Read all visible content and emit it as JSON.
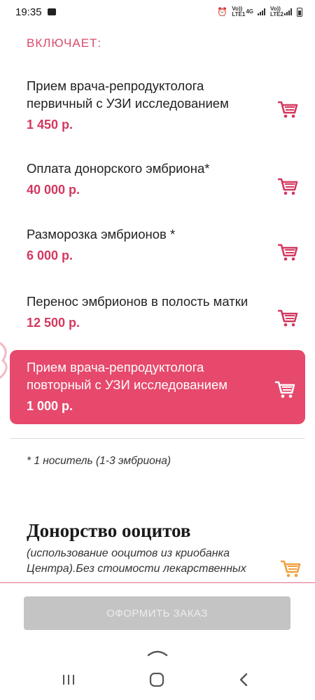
{
  "status": {
    "time": "19:35",
    "sim1_label": "Vo)) LTE1",
    "net": "4G",
    "sim2_label": "Vo)) LTE2"
  },
  "includes_label": "ВКЛЮЧАЕТ:",
  "items": [
    {
      "title": "Прием врача-репродуктолога первичный с УЗИ исследованием",
      "price": "1 450 р."
    },
    {
      "title": "Оплата донорского эмбриона*",
      "price": "40 000 р."
    },
    {
      "title": "Разморозка эмбрионов *",
      "price": "6 000 р."
    },
    {
      "title": "Перенос эмбрионов в полость матки",
      "price": "12 500 р."
    },
    {
      "title": "Прием врача-репродуктолога повторный с УЗИ исследованием",
      "price": "1 000 р.",
      "selected": true
    }
  ],
  "footnote": "* 1 носитель (1-3 эмбриона)",
  "section2": {
    "title": "Донорство ооцитов",
    "description": "(использование ооцитов из криобанка Центра).Без стоимости лекарственных"
  },
  "order_button": "ОФОРМИТЬ ЗАКАЗ",
  "colors": {
    "accent": "#e6496c",
    "price": "#d3385f",
    "cart_orange": "#f0a040",
    "button_disabled": "#c4c4c4"
  },
  "icons": [
    "cart-icon",
    "chevron-up-icon",
    "recent-apps-icon",
    "home-icon",
    "back-icon"
  ]
}
